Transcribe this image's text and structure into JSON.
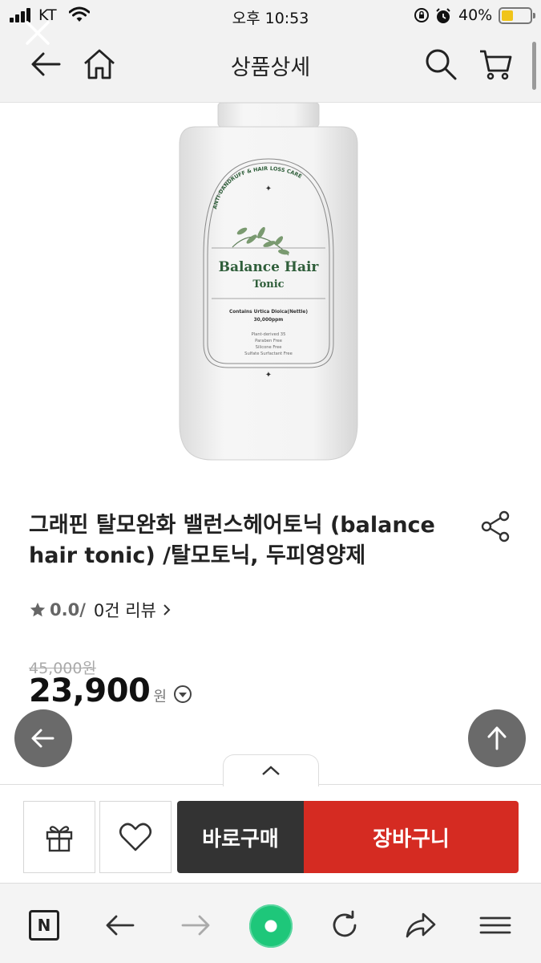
{
  "status_bar": {
    "carrier": "KT",
    "time": "오후 10:53",
    "battery": "40%",
    "battery_level": 0.4
  },
  "header": {
    "title": "상품상세",
    "back_icon": "arrow-left-icon",
    "home_icon": "home-icon",
    "search_icon": "search-icon",
    "cart_icon": "cart-icon"
  },
  "product": {
    "image_label": {
      "arc_text": "ANTI-DANDRUFF & HAIR LOSS CARE",
      "brand_line1": "Balance Hair",
      "brand_line2": "Tonic",
      "contains": "Contains Urtica Dioica(Nettle)",
      "ppm": "30,000ppm",
      "features": [
        "Plant-derived 35",
        "Paraben Free",
        "Silicone Free",
        "Sulfate Surfactant Free"
      ]
    },
    "title": "그래핀 탈모완화 밸런스헤어토닉 (balance hair tonic) /탈모토닉, 두피영양제",
    "rating": "0.0",
    "rating_sep": "/",
    "review_text": "0건 리뷰",
    "original_price": "45,000원",
    "price": "23,900",
    "currency": "원"
  },
  "actions": {
    "buy_now": "바로구매",
    "add_to_cart": "장바구니",
    "gift_icon": "gift-icon",
    "wish_icon": "heart-icon"
  },
  "colors": {
    "accent_red": "#d52b22",
    "buy_dark": "#333333",
    "label_green": "#2f5e3a"
  },
  "browser_bar": {
    "naver_label": "N",
    "icons": [
      "naver-icon",
      "back-icon",
      "forward-icon",
      "home-orb-icon",
      "refresh-icon",
      "share-icon",
      "menu-icon"
    ]
  }
}
